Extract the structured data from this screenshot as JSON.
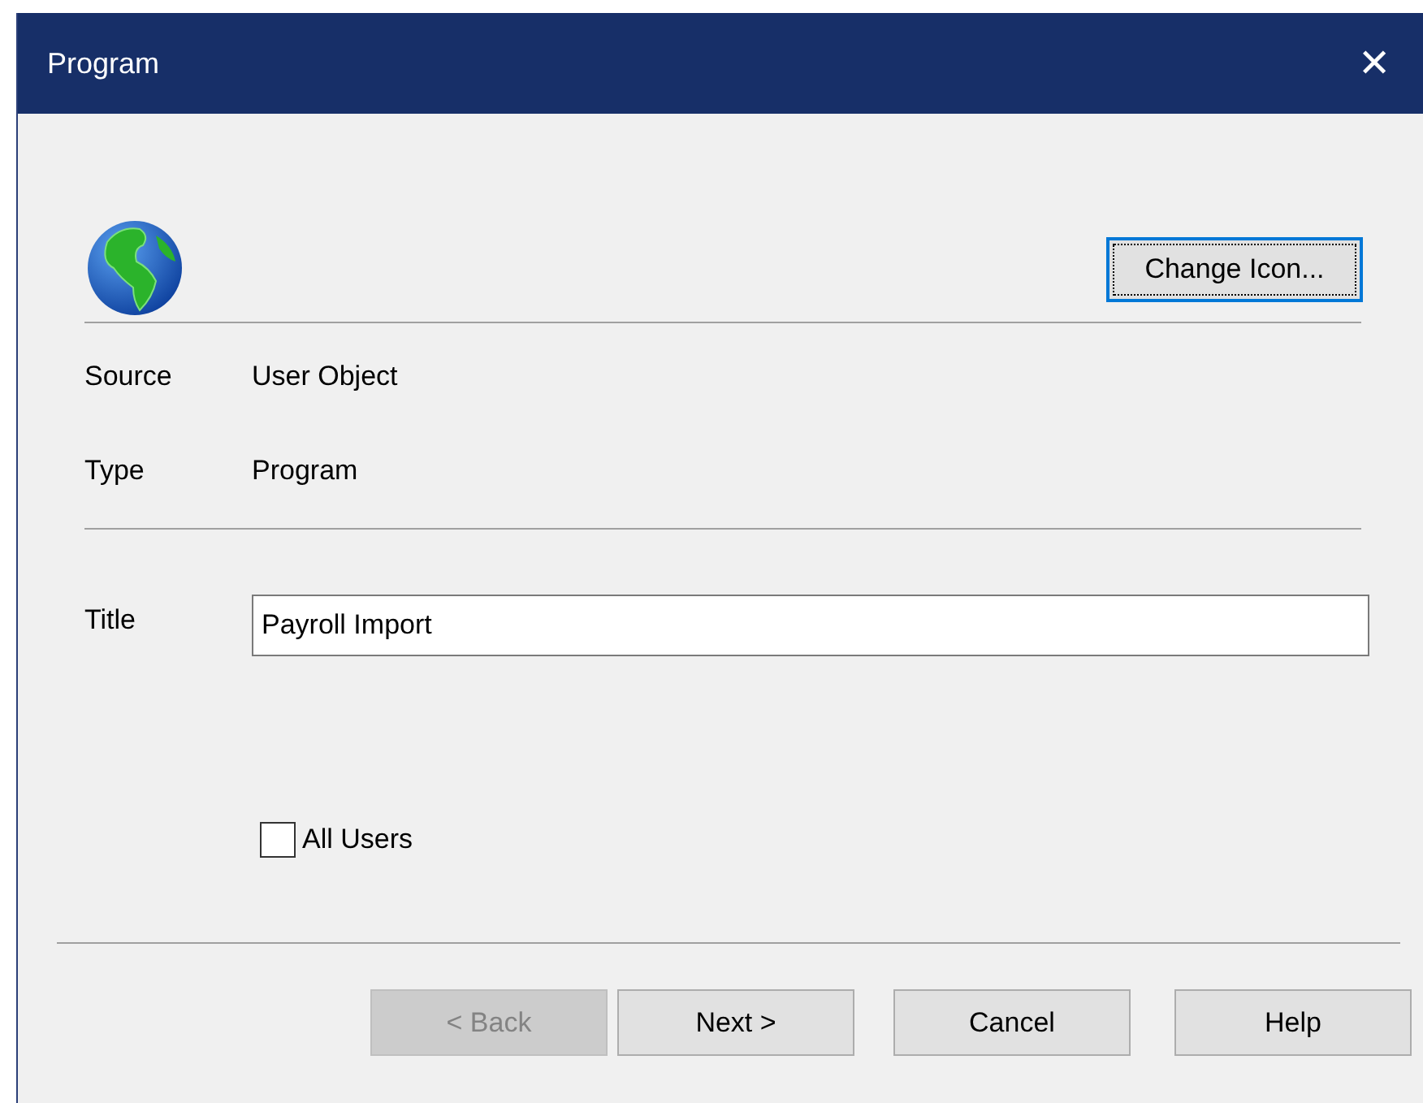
{
  "window": {
    "title": "Program",
    "close_glyph": "✕"
  },
  "change_icon_button": {
    "label": "Change Icon...",
    "focused": true
  },
  "properties": [
    {
      "label": "Source",
      "value": "User Object"
    },
    {
      "label": "Type",
      "value": "Program"
    }
  ],
  "title_field": {
    "label": "Title",
    "value": "Payroll Import"
  },
  "all_users": {
    "label": "All Users",
    "checked": false
  },
  "buttons": [
    {
      "label": "< Back",
      "disabled": true
    },
    {
      "label": "Next >",
      "disabled": false
    },
    {
      "label": "Cancel",
      "disabled": false
    },
    {
      "label": "Help",
      "disabled": false
    }
  ]
}
